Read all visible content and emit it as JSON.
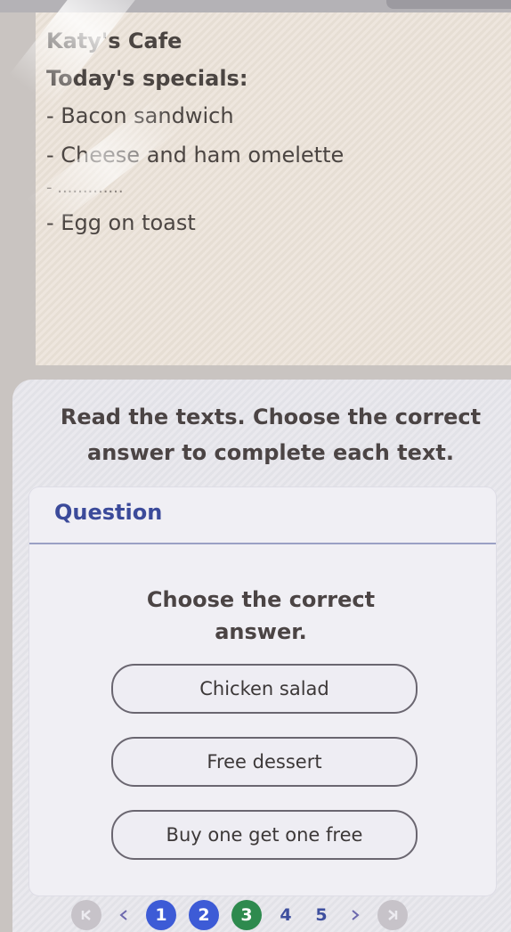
{
  "note": {
    "title": "Katy's Cafe",
    "specials_heading": "Today's specials:",
    "items": [
      "- Bacon sandwich",
      "- Cheese and ham omelette",
      "- .............",
      "- Egg on toast"
    ]
  },
  "instructions": "Read the texts. Choose the correct answer to complete each text.",
  "question": {
    "label": "Question",
    "prompt": "Choose the correct answer.",
    "options": [
      "Chicken salad",
      "Free dessert",
      "Buy one get one free"
    ]
  },
  "pagination": {
    "pages": [
      "1",
      "2",
      "3",
      "4",
      "5"
    ],
    "current": "3"
  },
  "colors": {
    "accent": "#3d5bd6",
    "current_page": "#2e8a4e",
    "question_label": "#3b4a9a"
  }
}
